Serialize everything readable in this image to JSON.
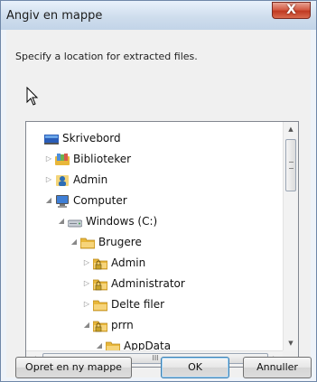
{
  "window": {
    "title": "Angiv en mappe",
    "close_glyph": "X"
  },
  "prompt": "Specify a location for extracted files.",
  "tree": [
    {
      "label": "Skrivebord",
      "expander": "",
      "icon": "desktop-icon"
    },
    {
      "label": "Biblioteker",
      "expander": "▷",
      "icon": "libraries-icon"
    },
    {
      "label": "Admin",
      "expander": "▷",
      "icon": "user-icon"
    },
    {
      "label": "Computer",
      "expander": "◢",
      "icon": "computer-icon"
    },
    {
      "label": "Windows (C:)",
      "expander": "◢",
      "icon": "drive-icon"
    },
    {
      "label": "Brugere",
      "expander": "◢",
      "icon": "folder-icon"
    },
    {
      "label": "Admin",
      "expander": "▷",
      "icon": "locked-folder-icon"
    },
    {
      "label": "Administrator",
      "expander": "▷",
      "icon": "locked-folder-icon"
    },
    {
      "label": "Delte filer",
      "expander": "▷",
      "icon": "folder-icon"
    },
    {
      "label": "prrn",
      "expander": "◢",
      "icon": "locked-folder-icon"
    },
    {
      "label": "AppData",
      "expander": "◢",
      "icon": "folder-icon"
    }
  ],
  "scrollbar": {
    "up": "▲",
    "down": "▼",
    "left": "◀",
    "right": "▶",
    "grip": "III"
  },
  "buttons": {
    "new_folder": "Opret en ny mappe",
    "ok": "OK",
    "cancel": "Annuller"
  },
  "colors": {
    "folder": "#e8b73a",
    "lock": "#c9a227",
    "close": "#c8432b"
  }
}
